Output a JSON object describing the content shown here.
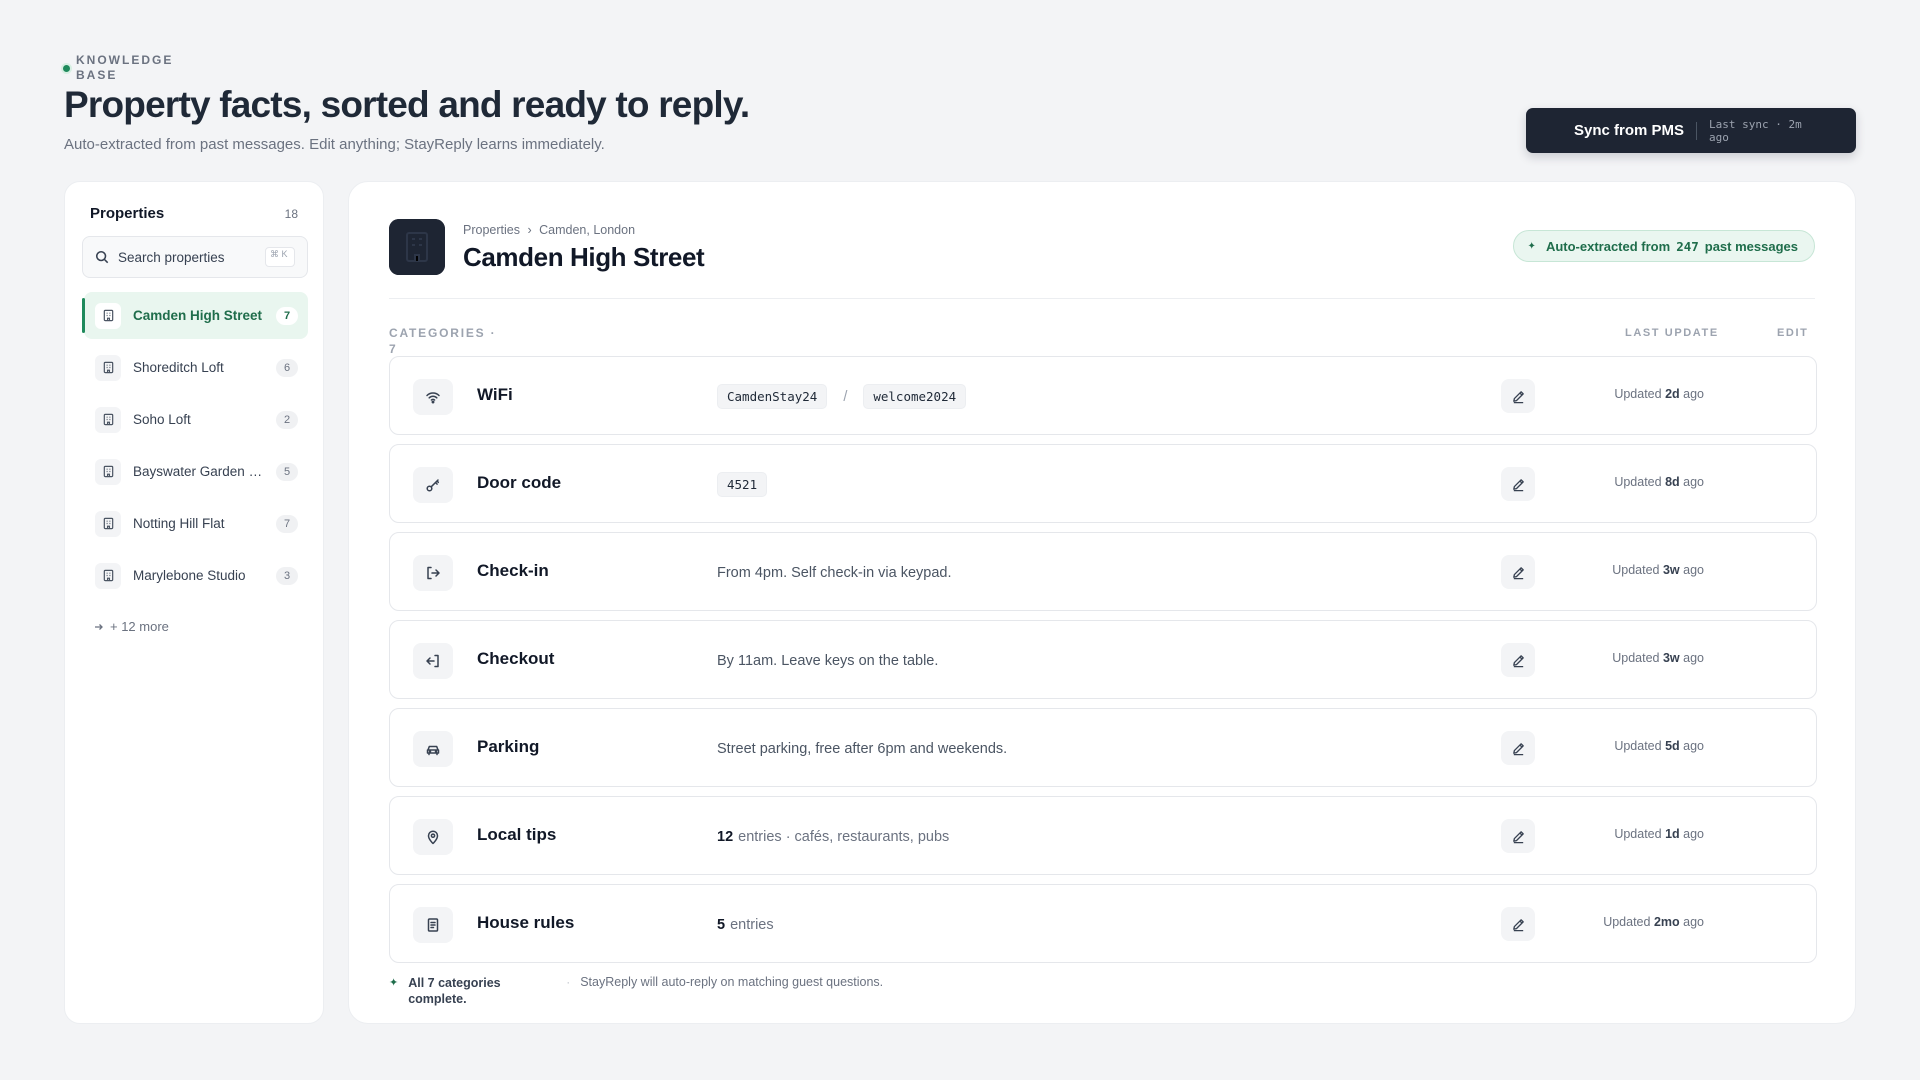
{
  "header": {
    "eyebrow": "KNOWLEDGE BASE",
    "title": "Property facts, sorted and ready to reply.",
    "subtitle": "Auto-extracted from past messages. Edit anything; StayReply learns immediately."
  },
  "sync": {
    "label": "Sync from PMS",
    "meta": "Last sync · 2m ago"
  },
  "sidebar": {
    "title": "Properties",
    "count": "18",
    "search_placeholder": "Search properties",
    "shortcut": "⌘ K",
    "items": [
      {
        "name": "Camden High Street",
        "count": "7"
      },
      {
        "name": "Shoreditch Loft",
        "count": "6"
      },
      {
        "name": "Soho Loft",
        "count": "2"
      },
      {
        "name": "Bayswater Garden Flat",
        "count": "5"
      },
      {
        "name": "Notting Hill Flat",
        "count": "7"
      },
      {
        "name": "Marylebone Studio",
        "count": "3"
      }
    ],
    "more_label": "+ 12 more"
  },
  "property": {
    "breadcrumb_root": "Properties",
    "breadcrumb_sep": "›",
    "breadcrumb_leaf": "Camden, London",
    "title": "Camden High Street",
    "extract_prefix": "Auto-extracted from",
    "extract_count": "247",
    "extract_suffix": "past messages"
  },
  "table": {
    "categories_label": "CATEGORIES · 7",
    "col_last_update": "LAST UPDATE",
    "col_edit": "EDIT",
    "updated_prefix": "Updated",
    "updated_suffix": "ago",
    "rows": [
      {
        "name": "WiFi",
        "icon": "wifi-icon",
        "network": "CamdenStay24",
        "separator": "/",
        "password": "welcome2024",
        "updated": "2d"
      },
      {
        "name": "Door code",
        "icon": "key-icon",
        "code": "4521",
        "updated": "8d"
      },
      {
        "name": "Check-in",
        "icon": "log-in-icon",
        "text": "From 4pm. Self check-in via keypad.",
        "updated": "3w"
      },
      {
        "name": "Checkout",
        "icon": "log-out-icon",
        "text": "By 11am. Leave keys on the table.",
        "updated": "3w"
      },
      {
        "name": "Parking",
        "icon": "car-icon",
        "text": "Street parking, free after 6pm and weekends.",
        "updated": "5d"
      },
      {
        "name": "Local tips",
        "icon": "map-pin-icon",
        "count": "12",
        "text": "entries · cafés, restaurants, pubs",
        "updated": "1d"
      },
      {
        "name": "House rules",
        "icon": "document-icon",
        "count": "5",
        "text": "entries",
        "updated": "2mo"
      }
    ]
  },
  "footer": {
    "status": "All 7 categories complete.",
    "separator": "·",
    "note": "StayReply will auto-reply on matching guest questions."
  },
  "colors": {
    "accent": "#1f8a5c",
    "accent_bg": "#e9f6ef",
    "dark": "#1e2533",
    "background": "#f3f4f6"
  }
}
